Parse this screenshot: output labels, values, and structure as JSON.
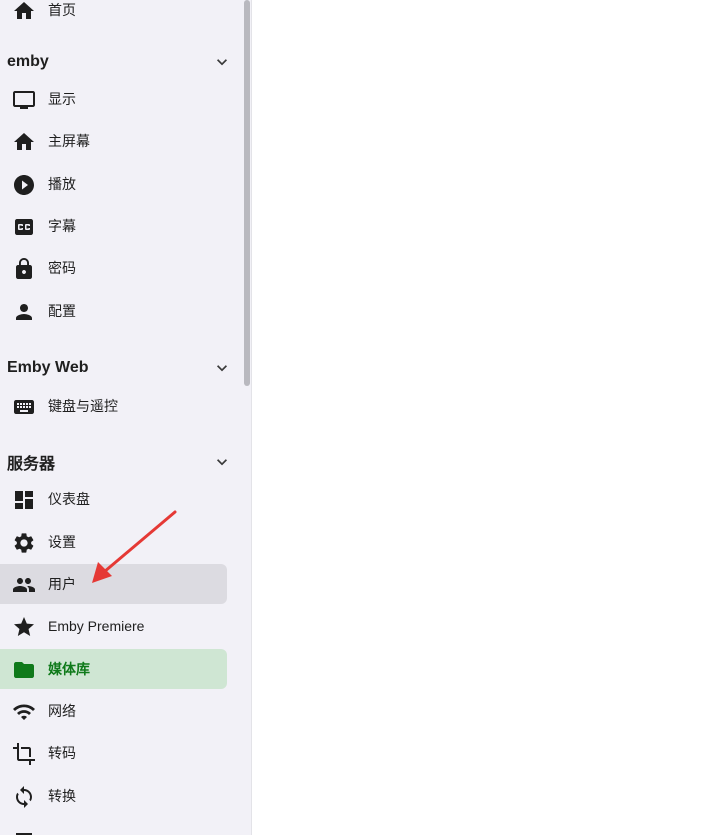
{
  "sidebar": {
    "top_item": {
      "label": "首页",
      "icon": "home-icon"
    },
    "sections": [
      {
        "title": "emby",
        "items": [
          {
            "label": "显示",
            "icon": "monitor-icon"
          },
          {
            "label": "主屏幕",
            "icon": "home-icon"
          },
          {
            "label": "播放",
            "icon": "play-circle-icon"
          },
          {
            "label": "字幕",
            "icon": "closed-caption-icon"
          },
          {
            "label": "密码",
            "icon": "lock-icon"
          },
          {
            "label": "配置",
            "icon": "person-icon"
          }
        ]
      },
      {
        "title": "Emby Web",
        "items": [
          {
            "label": "键盘与遥控",
            "icon": "keyboard-icon"
          }
        ]
      },
      {
        "title": "服务器",
        "items": [
          {
            "label": "仪表盘",
            "icon": "dashboard-icon"
          },
          {
            "label": "设置",
            "icon": "gear-icon"
          },
          {
            "label": "用户",
            "icon": "people-icon",
            "state": "hover"
          },
          {
            "label": "Emby Premiere",
            "icon": "star-icon"
          },
          {
            "label": "媒体库",
            "icon": "folder-icon",
            "state": "selected"
          },
          {
            "label": "网络",
            "icon": "wifi-icon"
          },
          {
            "label": "转码",
            "icon": "crop-icon"
          },
          {
            "label": "转换",
            "icon": "sync-icon"
          }
        ]
      }
    ]
  },
  "colors": {
    "sidebar_bg": "#f2f1f7",
    "hover_bg": "#dcdbe1",
    "selected_bg": "#cfe6d3",
    "selected_text": "#0f7a1a",
    "annotation_arrow": "#e53935"
  }
}
